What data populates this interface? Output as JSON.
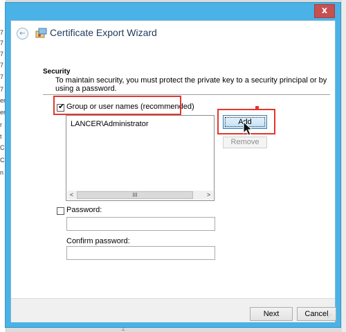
{
  "window": {
    "title": "Certificate Export Wizard",
    "close_glyph": "x",
    "back_glyph": "←"
  },
  "background": {
    "edge_chars": [
      "7",
      "7",
      "7",
      "7",
      "7",
      "7",
      "er",
      "er",
      "r",
      "t",
      "C",
      "C",
      "n"
    ]
  },
  "security": {
    "section_title": "Security",
    "description": "To maintain security, you must protect the private key to a security principal or by using a password.",
    "group_checkbox_label": "Group or user names (recommended)",
    "group_checked": true,
    "principals": [
      "LANCER\\Administrator"
    ],
    "scroll": {
      "left": "<",
      "right": ">",
      "thumb": "III"
    },
    "add_button": "Add",
    "remove_button": "Remove",
    "password_checkbox_label": "Password:",
    "password_checked": false,
    "password_value": "",
    "confirm_label": "Confirm password:",
    "confirm_value": ""
  },
  "footer": {
    "next_button": "Next",
    "cancel_button": "Cancel"
  },
  "icons": {
    "close": "close-icon",
    "back": "back-arrow-icon",
    "wizard": "certificate-wizard-icon",
    "cursor": "mouse-pointer-icon"
  },
  "colors": {
    "window_border": "#4ab2e6",
    "highlight_box": "#e3352f",
    "close_button": "#c75050"
  }
}
